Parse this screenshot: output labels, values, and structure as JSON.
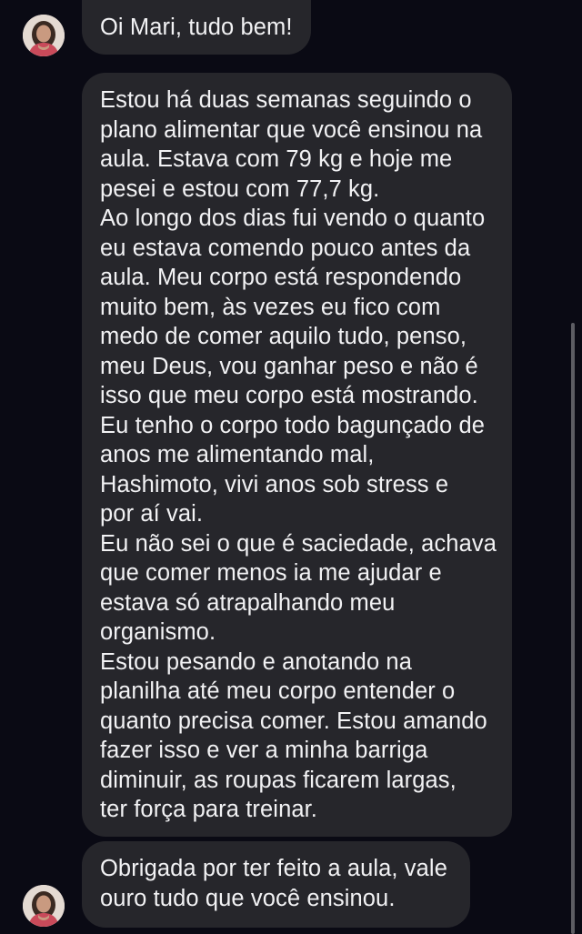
{
  "conversation": {
    "contact_avatar": "contact-avatar",
    "messages": [
      {
        "lines": [
          "Oi Mari, tudo bem!"
        ]
      },
      {
        "lines": [
          "Estou há duas semanas seguindo o",
          "plano alimentar que você ensinou na",
          "aula. Estava com 79 kg e hoje me",
          "pesei e estou com 77,7 kg.",
          "Ao longo dos dias fui vendo o quanto",
          "eu estava comendo pouco antes da",
          "aula. Meu corpo está respondendo",
          "muito bem, às vezes eu fico com",
          "medo de comer aquilo tudo, penso,",
          "meu Deus, vou ganhar peso e não é",
          "isso que meu corpo está mostrando.",
          "Eu tenho o corpo todo bagunçado de",
          "anos me alimentando mal,",
          "Hashimoto, vivi anos sob stress e",
          "por aí vai.",
          "Eu não sei o que é saciedade, achava",
          "que comer menos ia me ajudar e",
          "estava só atrapalhando meu",
          "organismo.",
          "Estou pesando e anotando na",
          "planilha até meu corpo entender o",
          "quanto precisa comer. Estou amando",
          "fazer isso e ver a minha barriga",
          "diminuir, as roupas ficarem largas,",
          "ter força para treinar."
        ]
      },
      {
        "lines": [
          "Obrigada por ter feito a aula, vale",
          "ouro tudo que você ensinou."
        ]
      }
    ]
  },
  "colors": {
    "background": "#0a0a14",
    "bubble": "#26262b",
    "text": "#f2f2f4",
    "scrollbar": "#5d5d63"
  }
}
